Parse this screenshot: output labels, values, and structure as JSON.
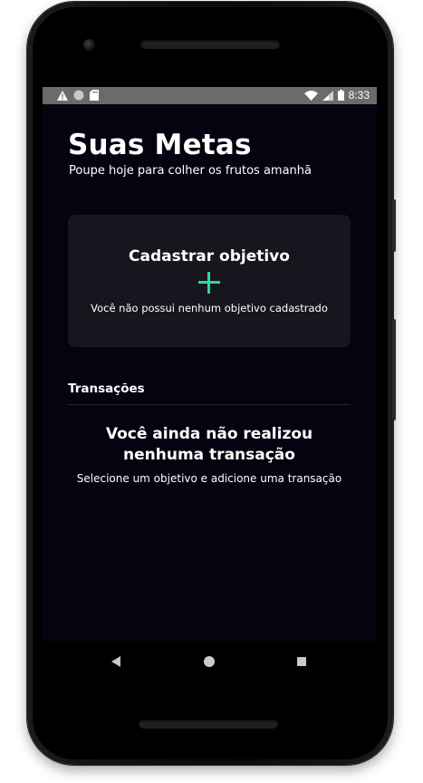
{
  "status_bar": {
    "time": "8:33",
    "icons_left": [
      "warning-icon",
      "circle-icon",
      "sd-card-icon"
    ],
    "icons_right": [
      "wifi-icon",
      "signal-icon",
      "battery-icon"
    ]
  },
  "header": {
    "title": "Suas Metas",
    "subtitle": "Poupe hoje para colher os frutos amanhã"
  },
  "goal_card": {
    "title": "Cadastrar objetivo",
    "add_icon": "plus-icon",
    "empty_text": "Você não possui nenhum objetivo cadastrado"
  },
  "transactions": {
    "section_title": "Transações",
    "empty_title": "Você ainda não realizou nenhuma transação",
    "empty_subtitle": "Selecione um objetivo e adicione uma transação"
  },
  "nav_bar": {
    "icons": [
      "back-icon",
      "home-icon",
      "recent-apps-icon"
    ]
  },
  "colors": {
    "background": "#03040f",
    "card": "#16171e",
    "accent": "#2bd8a0",
    "status_bar": "#6b6b6b"
  }
}
